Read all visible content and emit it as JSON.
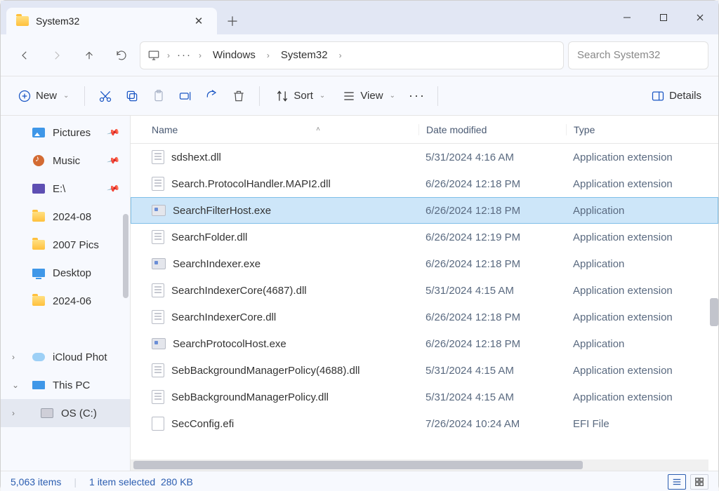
{
  "window": {
    "tab_title": "System32",
    "minimize": "—",
    "maximize": "□",
    "close": "✕"
  },
  "nav": {
    "breadcrumb": [
      "Windows",
      "System32"
    ],
    "search_placeholder": "Search System32"
  },
  "toolbar": {
    "new_label": "New",
    "sort_label": "Sort",
    "view_label": "View",
    "details_label": "Details"
  },
  "sidebar": {
    "items": [
      {
        "label": "Pictures",
        "icon": "pic",
        "pinned": true
      },
      {
        "label": "Music",
        "icon": "music",
        "pinned": true
      },
      {
        "label": "E:\\",
        "icon": "drive",
        "pinned": true
      },
      {
        "label": "2024-08",
        "icon": "folder"
      },
      {
        "label": "2007 Pics",
        "icon": "folder"
      },
      {
        "label": "Desktop",
        "icon": "desk"
      },
      {
        "label": "2024-06",
        "icon": "folder"
      }
    ],
    "lower": [
      {
        "label": "iCloud Phot",
        "icon": "cloud",
        "chev": "›"
      },
      {
        "label": "This PC",
        "icon": "pc",
        "chev": "⌄"
      },
      {
        "label": "OS (C:)",
        "icon": "os",
        "chev": "›",
        "selected": true,
        "indent": true
      }
    ]
  },
  "columns": {
    "name": "Name",
    "date": "Date modified",
    "type": "Type"
  },
  "files": [
    {
      "name": "sdshext.dll",
      "date": "5/31/2024 4:16 AM",
      "type": "Application extension",
      "kind": "dll"
    },
    {
      "name": "Search.ProtocolHandler.MAPI2.dll",
      "date": "6/26/2024 12:18 PM",
      "type": "Application extension",
      "kind": "dll"
    },
    {
      "name": "SearchFilterHost.exe",
      "date": "6/26/2024 12:18 PM",
      "type": "Application",
      "kind": "exe",
      "selected": true
    },
    {
      "name": "SearchFolder.dll",
      "date": "6/26/2024 12:19 PM",
      "type": "Application extension",
      "kind": "dll"
    },
    {
      "name": "SearchIndexer.exe",
      "date": "6/26/2024 12:18 PM",
      "type": "Application",
      "kind": "exe"
    },
    {
      "name": "SearchIndexerCore(4687).dll",
      "date": "5/31/2024 4:15 AM",
      "type": "Application extension",
      "kind": "dll"
    },
    {
      "name": "SearchIndexerCore.dll",
      "date": "6/26/2024 12:18 PM",
      "type": "Application extension",
      "kind": "dll"
    },
    {
      "name": "SearchProtocolHost.exe",
      "date": "6/26/2024 12:18 PM",
      "type": "Application",
      "kind": "exe"
    },
    {
      "name": "SebBackgroundManagerPolicy(4688).dll",
      "date": "5/31/2024 4:15 AM",
      "type": "Application extension",
      "kind": "dll"
    },
    {
      "name": "SebBackgroundManagerPolicy.dll",
      "date": "5/31/2024 4:15 AM",
      "type": "Application extension",
      "kind": "dll"
    },
    {
      "name": "SecConfig.efi",
      "date": "7/26/2024 10:24 AM",
      "type": "EFI File",
      "kind": "efi"
    }
  ],
  "status": {
    "count": "5,063 items",
    "selection": "1 item selected",
    "size": "280 KB"
  }
}
